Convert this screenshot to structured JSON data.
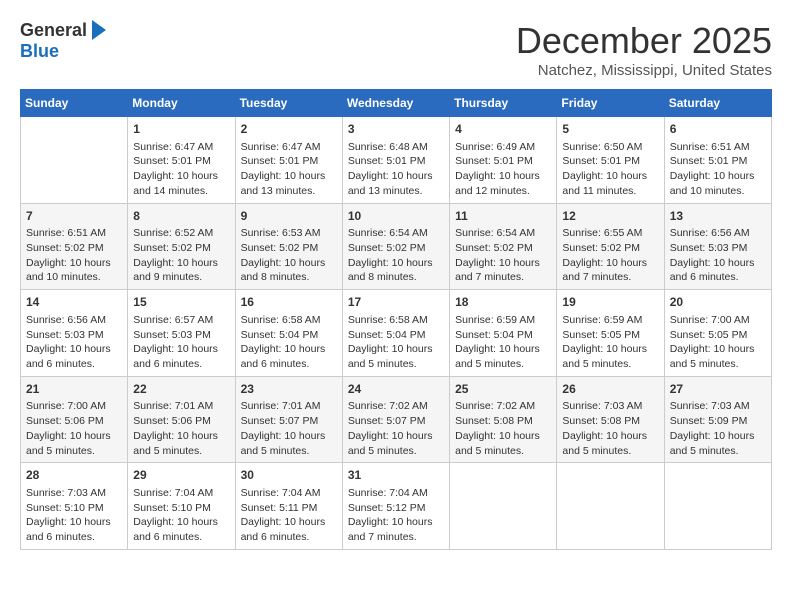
{
  "logo": {
    "general": "General",
    "blue": "Blue"
  },
  "title": "December 2025",
  "location": "Natchez, Mississippi, United States",
  "weekdays": [
    "Sunday",
    "Monday",
    "Tuesday",
    "Wednesday",
    "Thursday",
    "Friday",
    "Saturday"
  ],
  "weeks": [
    [
      {
        "day": "",
        "info": ""
      },
      {
        "day": "1",
        "info": "Sunrise: 6:47 AM\nSunset: 5:01 PM\nDaylight: 10 hours\nand 14 minutes."
      },
      {
        "day": "2",
        "info": "Sunrise: 6:47 AM\nSunset: 5:01 PM\nDaylight: 10 hours\nand 13 minutes."
      },
      {
        "day": "3",
        "info": "Sunrise: 6:48 AM\nSunset: 5:01 PM\nDaylight: 10 hours\nand 13 minutes."
      },
      {
        "day": "4",
        "info": "Sunrise: 6:49 AM\nSunset: 5:01 PM\nDaylight: 10 hours\nand 12 minutes."
      },
      {
        "day": "5",
        "info": "Sunrise: 6:50 AM\nSunset: 5:01 PM\nDaylight: 10 hours\nand 11 minutes."
      },
      {
        "day": "6",
        "info": "Sunrise: 6:51 AM\nSunset: 5:01 PM\nDaylight: 10 hours\nand 10 minutes."
      }
    ],
    [
      {
        "day": "7",
        "info": "Sunrise: 6:51 AM\nSunset: 5:02 PM\nDaylight: 10 hours\nand 10 minutes."
      },
      {
        "day": "8",
        "info": "Sunrise: 6:52 AM\nSunset: 5:02 PM\nDaylight: 10 hours\nand 9 minutes."
      },
      {
        "day": "9",
        "info": "Sunrise: 6:53 AM\nSunset: 5:02 PM\nDaylight: 10 hours\nand 8 minutes."
      },
      {
        "day": "10",
        "info": "Sunrise: 6:54 AM\nSunset: 5:02 PM\nDaylight: 10 hours\nand 8 minutes."
      },
      {
        "day": "11",
        "info": "Sunrise: 6:54 AM\nSunset: 5:02 PM\nDaylight: 10 hours\nand 7 minutes."
      },
      {
        "day": "12",
        "info": "Sunrise: 6:55 AM\nSunset: 5:02 PM\nDaylight: 10 hours\nand 7 minutes."
      },
      {
        "day": "13",
        "info": "Sunrise: 6:56 AM\nSunset: 5:03 PM\nDaylight: 10 hours\nand 6 minutes."
      }
    ],
    [
      {
        "day": "14",
        "info": "Sunrise: 6:56 AM\nSunset: 5:03 PM\nDaylight: 10 hours\nand 6 minutes."
      },
      {
        "day": "15",
        "info": "Sunrise: 6:57 AM\nSunset: 5:03 PM\nDaylight: 10 hours\nand 6 minutes."
      },
      {
        "day": "16",
        "info": "Sunrise: 6:58 AM\nSunset: 5:04 PM\nDaylight: 10 hours\nand 6 minutes."
      },
      {
        "day": "17",
        "info": "Sunrise: 6:58 AM\nSunset: 5:04 PM\nDaylight: 10 hours\nand 5 minutes."
      },
      {
        "day": "18",
        "info": "Sunrise: 6:59 AM\nSunset: 5:04 PM\nDaylight: 10 hours\nand 5 minutes."
      },
      {
        "day": "19",
        "info": "Sunrise: 6:59 AM\nSunset: 5:05 PM\nDaylight: 10 hours\nand 5 minutes."
      },
      {
        "day": "20",
        "info": "Sunrise: 7:00 AM\nSunset: 5:05 PM\nDaylight: 10 hours\nand 5 minutes."
      }
    ],
    [
      {
        "day": "21",
        "info": "Sunrise: 7:00 AM\nSunset: 5:06 PM\nDaylight: 10 hours\nand 5 minutes."
      },
      {
        "day": "22",
        "info": "Sunrise: 7:01 AM\nSunset: 5:06 PM\nDaylight: 10 hours\nand 5 minutes."
      },
      {
        "day": "23",
        "info": "Sunrise: 7:01 AM\nSunset: 5:07 PM\nDaylight: 10 hours\nand 5 minutes."
      },
      {
        "day": "24",
        "info": "Sunrise: 7:02 AM\nSunset: 5:07 PM\nDaylight: 10 hours\nand 5 minutes."
      },
      {
        "day": "25",
        "info": "Sunrise: 7:02 AM\nSunset: 5:08 PM\nDaylight: 10 hours\nand 5 minutes."
      },
      {
        "day": "26",
        "info": "Sunrise: 7:03 AM\nSunset: 5:08 PM\nDaylight: 10 hours\nand 5 minutes."
      },
      {
        "day": "27",
        "info": "Sunrise: 7:03 AM\nSunset: 5:09 PM\nDaylight: 10 hours\nand 5 minutes."
      }
    ],
    [
      {
        "day": "28",
        "info": "Sunrise: 7:03 AM\nSunset: 5:10 PM\nDaylight: 10 hours\nand 6 minutes."
      },
      {
        "day": "29",
        "info": "Sunrise: 7:04 AM\nSunset: 5:10 PM\nDaylight: 10 hours\nand 6 minutes."
      },
      {
        "day": "30",
        "info": "Sunrise: 7:04 AM\nSunset: 5:11 PM\nDaylight: 10 hours\nand 6 minutes."
      },
      {
        "day": "31",
        "info": "Sunrise: 7:04 AM\nSunset: 5:12 PM\nDaylight: 10 hours\nand 7 minutes."
      },
      {
        "day": "",
        "info": ""
      },
      {
        "day": "",
        "info": ""
      },
      {
        "day": "",
        "info": ""
      }
    ]
  ]
}
